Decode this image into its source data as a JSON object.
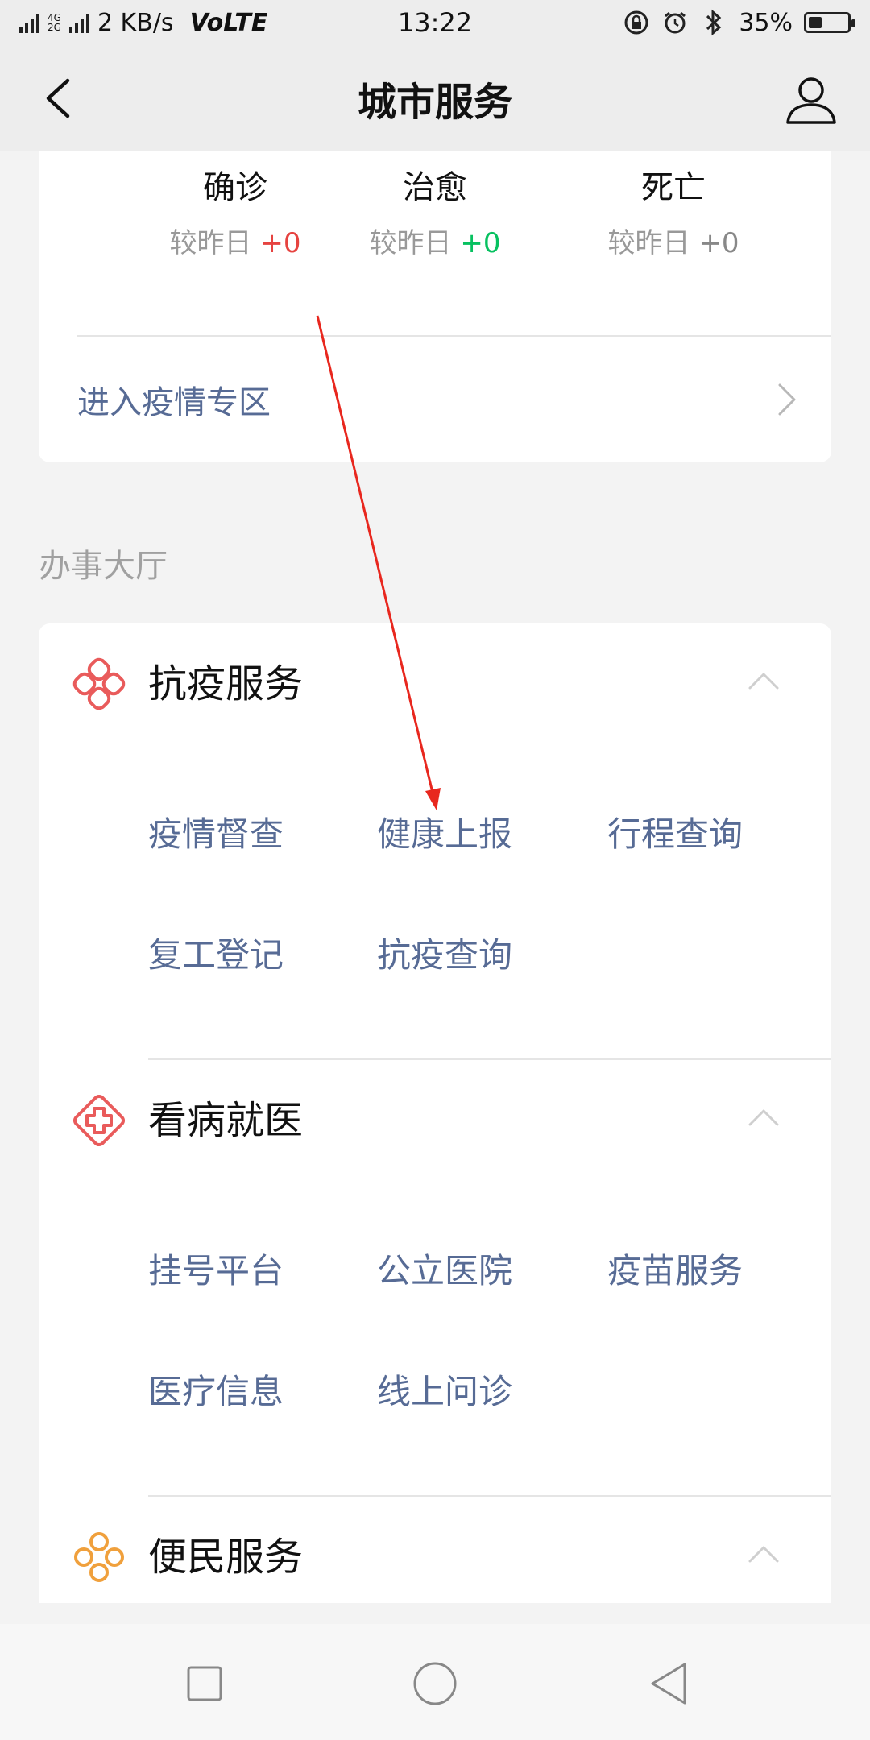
{
  "status_bar": {
    "network_top": "4G",
    "network_bottom": "2G",
    "speed": "2 KB/s",
    "volte": "VoLTE",
    "time": "13:22",
    "battery": "35%",
    "battery_level": 0.35
  },
  "header": {
    "title": "城市服务",
    "back_icon": "chevron-left-icon",
    "profile_icon": "user-icon"
  },
  "stats": {
    "items": [
      {
        "label": "确诊",
        "delta_prefix": "较昨日 ",
        "delta_value": "+0",
        "color": "#e64340"
      },
      {
        "label": "治愈",
        "delta_prefix": "较昨日 ",
        "delta_value": "+0",
        "color": "#07c160"
      },
      {
        "label": "死亡",
        "delta_prefix": "较昨日 ",
        "delta_value": "+0",
        "color": "#888888"
      }
    ],
    "enter_label": "进入疫情专区"
  },
  "section_heading": "办事大厅",
  "categories": [
    {
      "title": "抗疫服务",
      "icon": "knot-icon",
      "icon_color": "#e95b5b",
      "items": [
        "疫情督查",
        "健康上报",
        "行程查询",
        "复工登记",
        "抗疫查询"
      ]
    },
    {
      "title": "看病就医",
      "icon": "medical-cross-icon",
      "icon_color": "#e95b5b",
      "items": [
        "挂号平台",
        "公立医院",
        "疫苗服务",
        "医疗信息",
        "线上问诊"
      ]
    },
    {
      "title": "便民服务",
      "icon": "clover-icon",
      "icon_color": "#f0a03c",
      "items": []
    }
  ],
  "nav": {
    "recent": "square-icon",
    "home": "circle-icon",
    "back": "triangle-back-icon"
  },
  "accent": {
    "link": "#576b95",
    "annotation": "#e8271e"
  }
}
